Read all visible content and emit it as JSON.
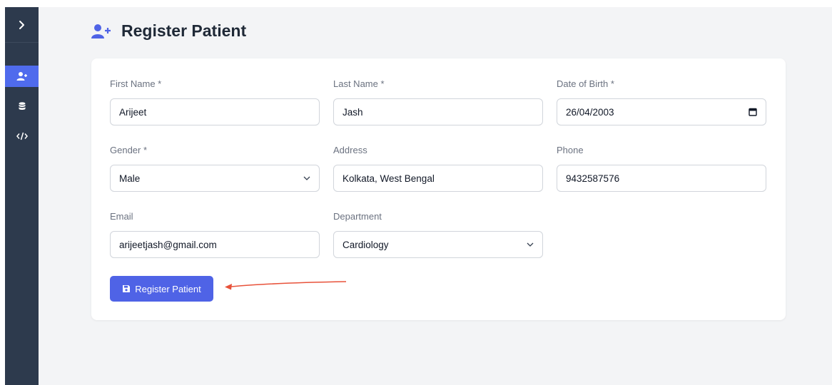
{
  "page": {
    "title": "Register Patient"
  },
  "sidebar": {
    "items": [
      {
        "name": "register-patient",
        "icon": "user-plus-icon",
        "active": true
      },
      {
        "name": "database",
        "icon": "database-icon",
        "active": false
      },
      {
        "name": "code",
        "icon": "code-icon",
        "active": false
      }
    ]
  },
  "form": {
    "first_name": {
      "label": "First Name *",
      "value": "Arijeet"
    },
    "last_name": {
      "label": "Last Name *",
      "value": "Jash"
    },
    "dob": {
      "label": "Date of Birth *",
      "value": "26/04/2003"
    },
    "gender": {
      "label": "Gender *",
      "value": "Male"
    },
    "address": {
      "label": "Address",
      "value": "Kolkata, West Bengal"
    },
    "phone": {
      "label": "Phone",
      "value": "9432587576"
    },
    "email": {
      "label": "Email",
      "value": "arijeetjash@gmail.com"
    },
    "department": {
      "label": "Department",
      "value": "Cardiology"
    },
    "submit_label": "Register Patient"
  },
  "colors": {
    "sidebar_bg": "#2d3a4d",
    "accent": "#4f63e6",
    "annotation_arrow": "#e8523a"
  }
}
